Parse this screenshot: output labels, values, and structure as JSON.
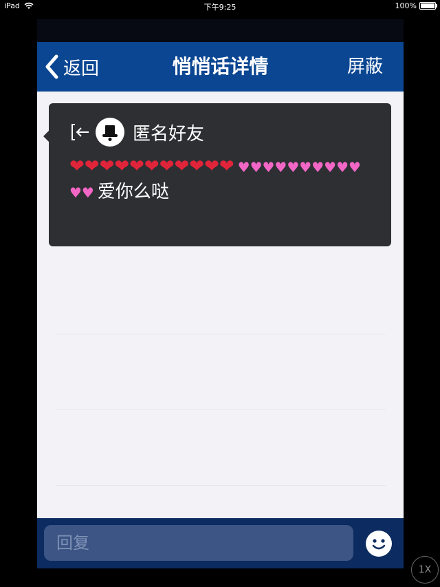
{
  "status_bar": {
    "device": "iPad",
    "time": "下午9:25",
    "battery": "100%"
  },
  "nav": {
    "back_label": "返回",
    "title": "悄悄话详情",
    "right_label": "屏蔽"
  },
  "message": {
    "sender": "匿名好友",
    "red_hearts": "❤❤❤❤❤❤❤❤❤❤❤",
    "pink_hearts": "♥♥♥♥♥♥♥♥♥♥♥♥",
    "text": "爱你么哒"
  },
  "reply": {
    "placeholder": "回复"
  },
  "zoom": "1X",
  "colors": {
    "nav_bg": "#0a4692",
    "bubble_bg": "#2e2f33",
    "reply_bar_bg": "#0c2b60",
    "input_bg": "#3c5585",
    "heart_red": "#e0243a",
    "heart_pink": "#f267c6"
  }
}
